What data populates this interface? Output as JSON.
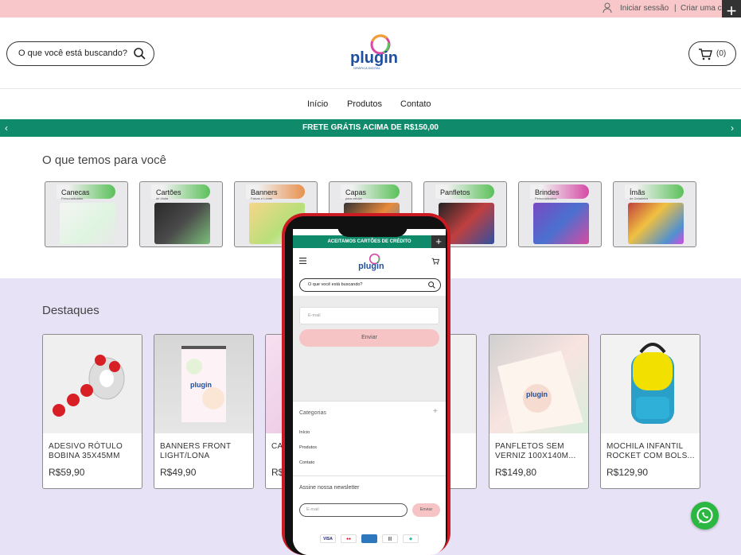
{
  "topbar": {
    "login": "Iniciar sessão",
    "separator": "|",
    "create": "Criar uma conta"
  },
  "header": {
    "search_placeholder": "O que você está buscando?",
    "cart_count": "(0)"
  },
  "nav": {
    "items": [
      "Início",
      "Produtos",
      "Contato"
    ]
  },
  "promo": {
    "text": "FRETE GRÁTIS ACIMA DE R$150,00",
    "prev": "‹",
    "next": "›"
  },
  "categories": {
    "title": "O que temos para você",
    "items": [
      {
        "name": "Canecas",
        "sub": "Personalizadas",
        "accent": "#5bc15a"
      },
      {
        "name": "Cartões",
        "sub": "de Visita",
        "accent": "#5bc15a"
      },
      {
        "name": "Banners",
        "sub": "Faixas e Lonas",
        "accent": "#e8914e"
      },
      {
        "name": "Capas",
        "sub": "para celular",
        "accent": "#5bc15a"
      },
      {
        "name": "Panfletos",
        "sub": "",
        "accent": "#5bc15a"
      },
      {
        "name": "Brindes",
        "sub": "Personalizados",
        "accent": "#d54aa5"
      },
      {
        "name": "Ímãs",
        "sub": "de Geladeira",
        "accent": "#5bc15a"
      }
    ]
  },
  "highlights": {
    "title": "Destaques",
    "products": [
      {
        "name": "ADESIVO RÓTULO BOBINA 35X45mm",
        "price": "R$59,90"
      },
      {
        "name": "BANNERS FRONT LIGHT/LONA",
        "price": "R$49,90"
      },
      {
        "name": "CA CE",
        "price": "R$"
      },
      {
        "name": "",
        "price": ""
      },
      {
        "name": "PANFLETOS SEM VERNIZ 100X140M...",
        "price": "R$149,80"
      },
      {
        "name": "MOCHILA INFANTIL ROCKET COM BOLS...",
        "price": "R$129,90"
      }
    ]
  },
  "phone": {
    "topbar": "ACEITAMOS CARTÕES DE CRÉDITO",
    "search_placeholder": "O que você está buscando?",
    "email_placeholder": "E-mail",
    "send_label": "Enviar",
    "categories_title": "Categorias",
    "links": [
      "Início",
      "Produtos",
      "Contato"
    ],
    "newsletter_title": "Assine nossa newsletter",
    "news_email_placeholder": "E-mail",
    "news_send_label": "Enviar",
    "payments": [
      "VISA",
      "MC",
      "AMEX",
      "BOL",
      "PIX"
    ]
  },
  "colors": {
    "topbar": "#f7c7ca",
    "promo": "#0f8a6a",
    "highlights_bg": "#e8e2f7",
    "phone_frame": "#cc1a22",
    "whatsapp": "#2cb742"
  }
}
